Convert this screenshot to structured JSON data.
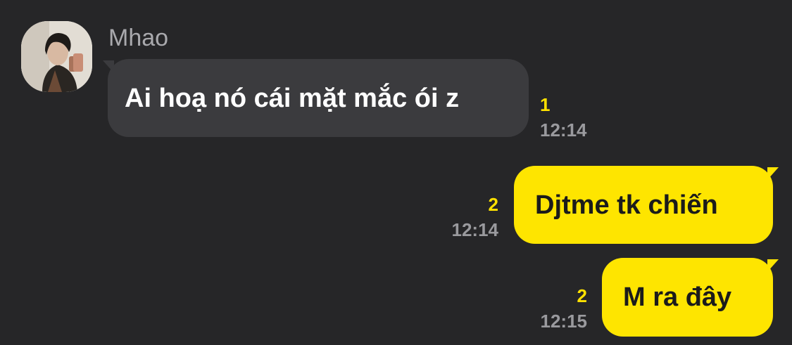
{
  "messages": [
    {
      "direction": "incoming",
      "sender": "Mhao",
      "avatar_icon": "profile-photo-icon",
      "text": "Ai hoạ nó cái mặt mắc ói z",
      "unread_count": "1",
      "time": "12:14"
    },
    {
      "direction": "outgoing",
      "text": "Djtme tk chiến",
      "unread_count": "2",
      "time": "12:14"
    },
    {
      "direction": "outgoing",
      "text": "M ra đây",
      "unread_count": "2",
      "time": "12:15"
    }
  ],
  "colors": {
    "background": "#262628",
    "incoming_bubble": "#3b3b3e",
    "outgoing_bubble": "#fee500",
    "unread_badge": "#ffe100",
    "timestamp": "#9a9a9e",
    "sender_name": "#a9a9ad"
  }
}
